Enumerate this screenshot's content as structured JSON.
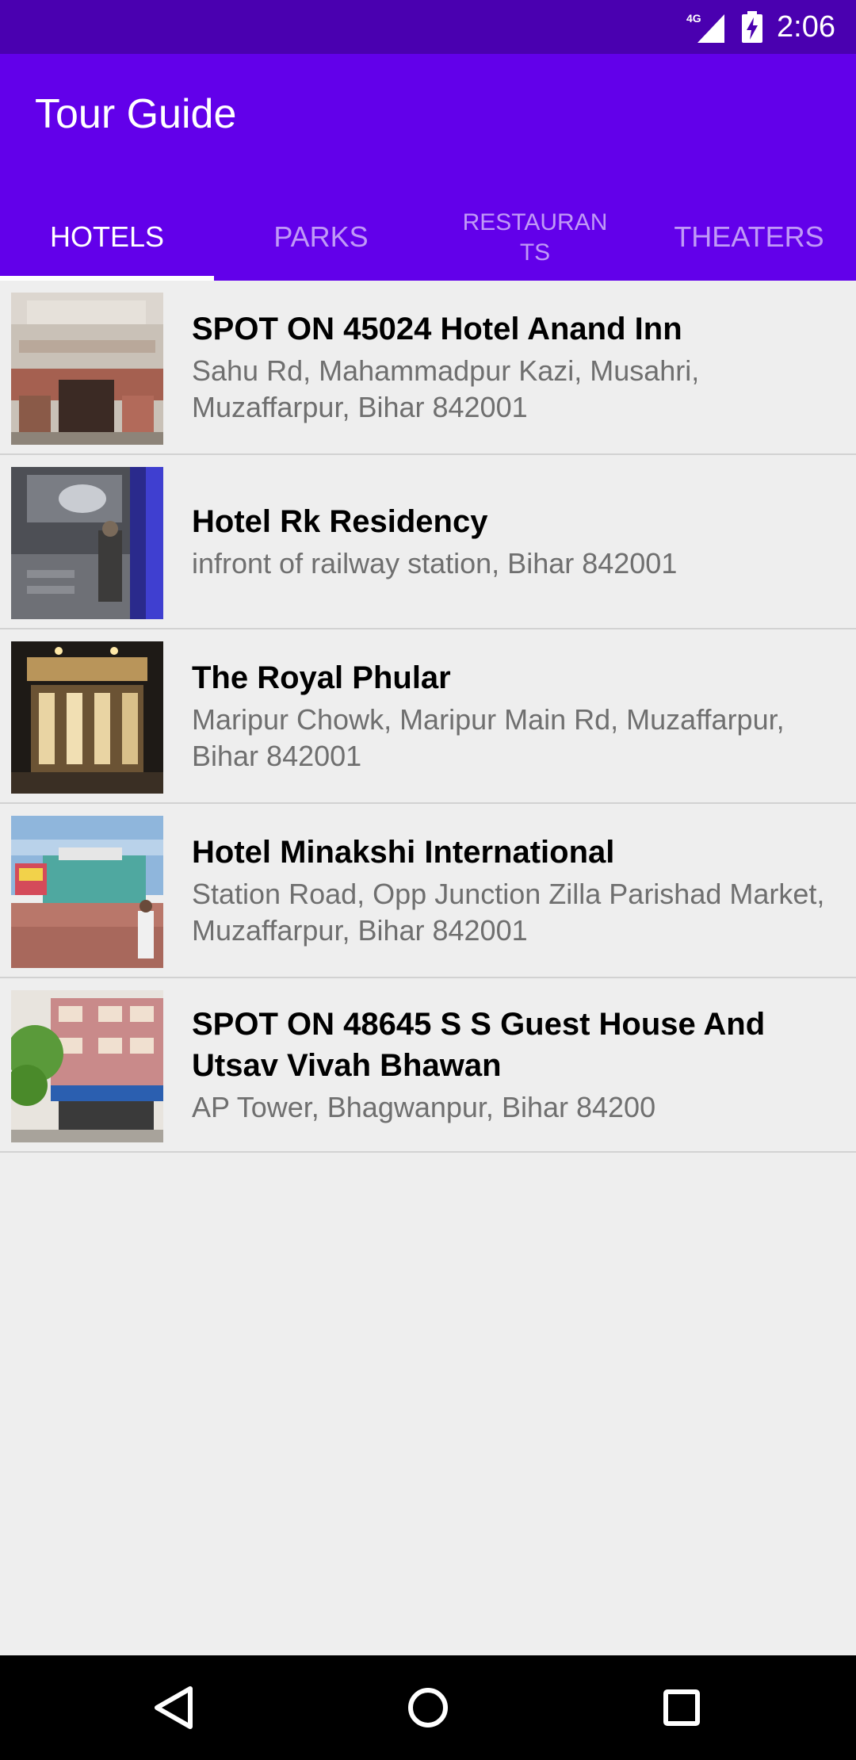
{
  "status_bar": {
    "network": "4G",
    "network_icon": "signal-icon",
    "battery_icon": "battery-charging-icon",
    "time": "2:06"
  },
  "app_bar": {
    "title": "Tour Guide",
    "background": "#6200ea"
  },
  "tabs": [
    {
      "label": "HOTELS",
      "active": true
    },
    {
      "label": "PARKS",
      "active": false
    },
    {
      "label": "RESTAURAN\nTS",
      "active": false
    },
    {
      "label": "THEATERS",
      "active": false
    }
  ],
  "hotels": [
    {
      "name": "SPOT ON 45024 Hotel Anand Inn",
      "address": "Sahu Rd, Mahammadpur Kazi, Musahri, Muzaffarpur, Bihar 842001"
    },
    {
      "name": "Hotel Rk Residency",
      "address": "infront of railway station, Bihar 842001"
    },
    {
      "name": "The Royal Phular",
      "address": "Maripur Chowk, Maripur Main Rd, Muzaffarpur, Bihar 842001"
    },
    {
      "name": "Hotel Minakshi International",
      "address": "Station Road, Opp Junction Zilla Parishad Market, Muzaffarpur, Bihar 842001"
    },
    {
      "name": "SPOT ON 48645 S S Guest House And Utsav Vivah Bhawan",
      "address": "AP Tower, Bhagwanpur, Bihar 84200"
    }
  ],
  "nav_bar": {
    "back_icon": "back-triangle-icon",
    "home_icon": "home-circle-icon",
    "recents_icon": "recents-square-icon"
  }
}
